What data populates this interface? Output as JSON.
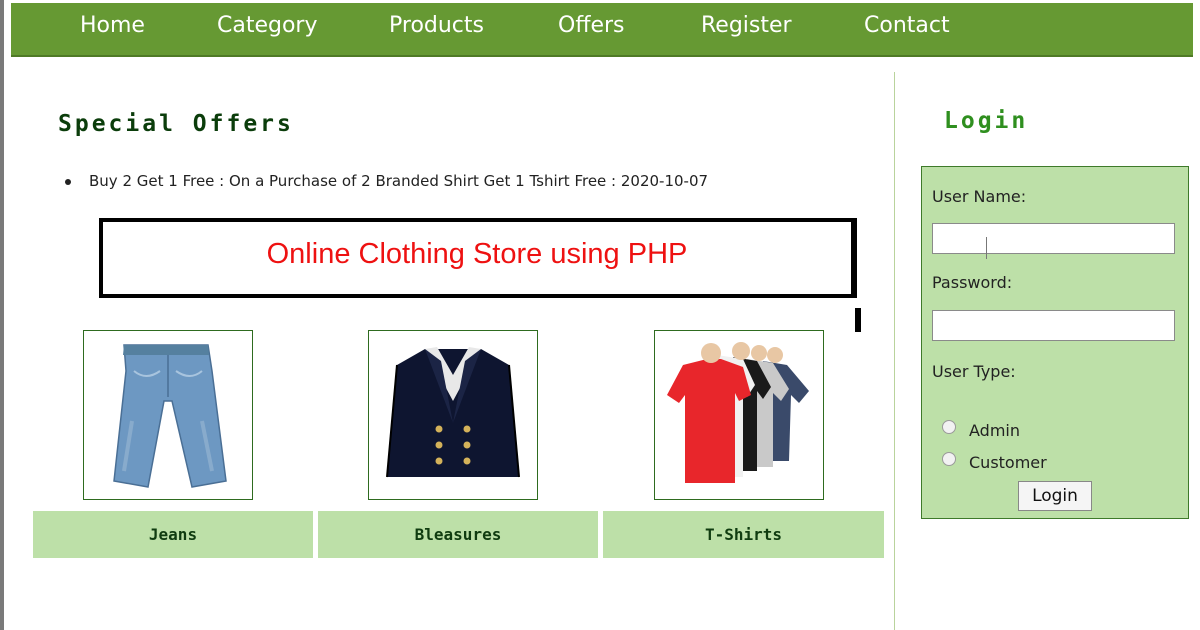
{
  "nav": {
    "items": [
      {
        "label": "Home"
      },
      {
        "label": "Category"
      },
      {
        "label": "Products"
      },
      {
        "label": "Offers"
      },
      {
        "label": "Register"
      },
      {
        "label": "Contact"
      }
    ]
  },
  "offers": {
    "title": "Special Offers",
    "items": [
      {
        "text": "Buy 2 Get 1 Free : On a Purchase of 2 Branded Shirt Get 1 Tshirt Free : 2020-10-07"
      }
    ]
  },
  "banner": {
    "text": "Online Clothing Store using PHP"
  },
  "categories": [
    {
      "label": "Jeans",
      "icon": "jeans-image"
    },
    {
      "label": "Bleasures",
      "icon": "blazer-image"
    },
    {
      "label": "T-Shirts",
      "icon": "tshirts-image"
    }
  ],
  "login": {
    "title": "Login",
    "username_label": "User Name:",
    "username_value": "",
    "password_label": "Password:",
    "password_value": "",
    "usertype_label": "User Type:",
    "options": [
      {
        "label": "Admin",
        "selected": false
      },
      {
        "label": "Customer",
        "selected": false
      }
    ],
    "button_label": "Login"
  },
  "colors": {
    "nav_bg": "#669933",
    "panel_bg": "#bde0a8",
    "banner_text": "#ee1111"
  }
}
